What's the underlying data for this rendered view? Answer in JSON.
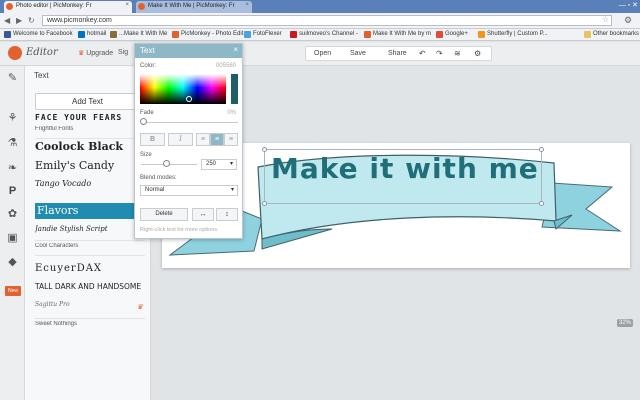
{
  "browser": {
    "tabs": [
      {
        "label": "Photo editor | PicMonkey: Fr"
      },
      {
        "label": "Make It With Me | PicMonkey: Fr"
      }
    ],
    "url": "www.picmonkey.com",
    "bookmarks": [
      {
        "label": "Welcome to Facebook",
        "color": "#3b5998"
      },
      {
        "label": "hotmail",
        "color": "#0072c6"
      },
      {
        "label": "...Make It With Me",
        "color": "#8a6d3b"
      },
      {
        "label": "PicMonkey - Photo Edit",
        "color": "#e2612d"
      },
      {
        "label": "FotoFlexer",
        "color": "#4aa3df"
      },
      {
        "label": "suilmoveo's Channel -",
        "color": "#cc181e"
      },
      {
        "label": "Make It With Me by m",
        "color": "#e2612d"
      },
      {
        "label": "Google+",
        "color": "#dd4b39"
      },
      {
        "label": "Shutterfly | Custom P...",
        "color": "#f7941d"
      },
      {
        "label": "Other bookmarks",
        "color": "#e8c45c"
      }
    ]
  },
  "app": {
    "logo_text": "Editor",
    "upgrade": "Upgrade",
    "signin": "Sig",
    "toolbar": {
      "open": "Open",
      "save": "Save",
      "share": "Share"
    },
    "zoom": "32%"
  },
  "panel": {
    "title": "Text",
    "add_text": "Add Text",
    "fonts": [
      {
        "label": "FACE YOUR FEARS",
        "kind": "font",
        "premium": false
      },
      {
        "label": "Frightful Fonts",
        "kind": "header",
        "premium": false
      },
      {
        "label": "Coolock Black",
        "kind": "font",
        "premium": true
      },
      {
        "label": "Emily's Candy",
        "kind": "font",
        "premium": false
      },
      {
        "label": "Tango Vocado",
        "kind": "font",
        "premium": true
      },
      {
        "label": "Flavors",
        "kind": "font",
        "premium": false,
        "selected": true
      },
      {
        "label": "Jandie Stylish Script",
        "kind": "font",
        "premium": true
      },
      {
        "label": "Cool Characters",
        "kind": "header",
        "premium": false
      },
      {
        "label": "EcuyerDAX",
        "kind": "font",
        "premium": false
      },
      {
        "label": "TALL DARK AND HANDSOME",
        "kind": "font",
        "premium": false
      },
      {
        "label": "Sagittu Pro",
        "kind": "font",
        "premium": true
      },
      {
        "label": "Sweet Nothings",
        "kind": "header",
        "premium": false
      }
    ]
  },
  "dialog": {
    "title": "Text",
    "color_label": "Color:",
    "color_hex": "005560",
    "fade_label": "Fade",
    "fade_value": "0%",
    "bold": "B",
    "italic": "I",
    "size_label": "Size",
    "size_value": "250",
    "size_fraction": 0.4,
    "blend_label": "Blend modes:",
    "blend_value": "Normal",
    "delete": "Delete",
    "hint": "Right-click text for more options."
  },
  "canvas": {
    "text": "Make it with me",
    "text_color": "#1f6e78"
  }
}
